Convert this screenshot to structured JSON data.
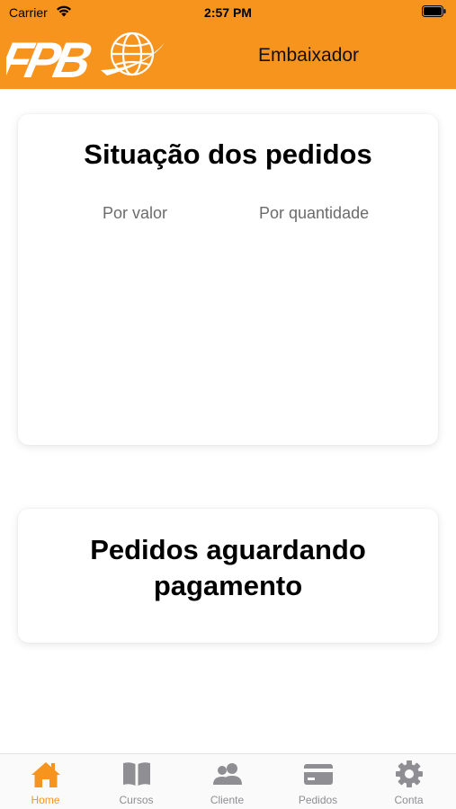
{
  "status_bar": {
    "carrier": "Carrier",
    "time": "2:57 PM"
  },
  "header": {
    "title": "Embaixador",
    "logo_text": "FPB",
    "background": "#f7941d"
  },
  "orders_status": {
    "title": "Situação dos pedidos",
    "tabs": [
      "Por valor",
      "Por quantidade"
    ]
  },
  "pending_payment": {
    "title": "Pedidos aguardando pagamento"
  },
  "tabbar": {
    "accent": "#f7941d",
    "inactive_color": "#8e8e93",
    "items": [
      {
        "label": "Home",
        "icon": "home-icon",
        "active": true
      },
      {
        "label": "Cursos",
        "icon": "book-icon",
        "active": false
      },
      {
        "label": "Cliente",
        "icon": "users-icon",
        "active": false
      },
      {
        "label": "Pedidos",
        "icon": "credit-card-icon",
        "active": false
      },
      {
        "label": "Conta",
        "icon": "gear-icon",
        "active": false
      }
    ]
  }
}
